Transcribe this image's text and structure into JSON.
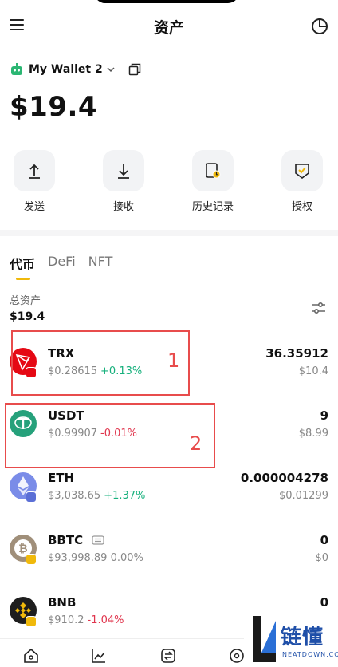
{
  "header": {
    "title": "资产"
  },
  "wallet": {
    "name": "My Wallet 2"
  },
  "balance": "$19.4",
  "actions": [
    {
      "label": "发送",
      "icon": "send-icon"
    },
    {
      "label": "接收",
      "icon": "receive-icon"
    },
    {
      "label": "历史记录",
      "icon": "history-icon"
    },
    {
      "label": "授权",
      "icon": "authorize-icon"
    }
  ],
  "tabs": [
    {
      "label": "代币",
      "active": true
    },
    {
      "label": "DeFi",
      "active": false
    },
    {
      "label": "NFT",
      "active": false
    }
  ],
  "total": {
    "label": "总资产",
    "value": "$19.4"
  },
  "tokens": [
    {
      "symbol": "TRX",
      "price": "$0.28615",
      "change": "+0.13%",
      "amount": "36.35912",
      "value": "$10.4"
    },
    {
      "symbol": "USDT",
      "price": "$0.99907",
      "change": "-0.01%",
      "amount": "9",
      "value": "$8.99"
    },
    {
      "symbol": "ETH",
      "price": "$3,038.65",
      "change": "+1.37%",
      "amount": "0.000004278",
      "value": "$0.01299"
    },
    {
      "symbol": "BBTC",
      "price": "$93,998.89",
      "change": "0.00%",
      "amount": "0",
      "value": "$0"
    },
    {
      "symbol": "BNB",
      "price": "$910.2",
      "change": "-1.04%",
      "amount": "0",
      "value": ""
    }
  ],
  "annotations": [
    "1",
    "2"
  ],
  "colors": {
    "accent": "#f0b90b",
    "up": "#16b07c",
    "down": "#e0354d",
    "annotation": "#e84c4c"
  },
  "watermark": {
    "text": "链懂",
    "sub": "NEATDOWN.COM"
  }
}
